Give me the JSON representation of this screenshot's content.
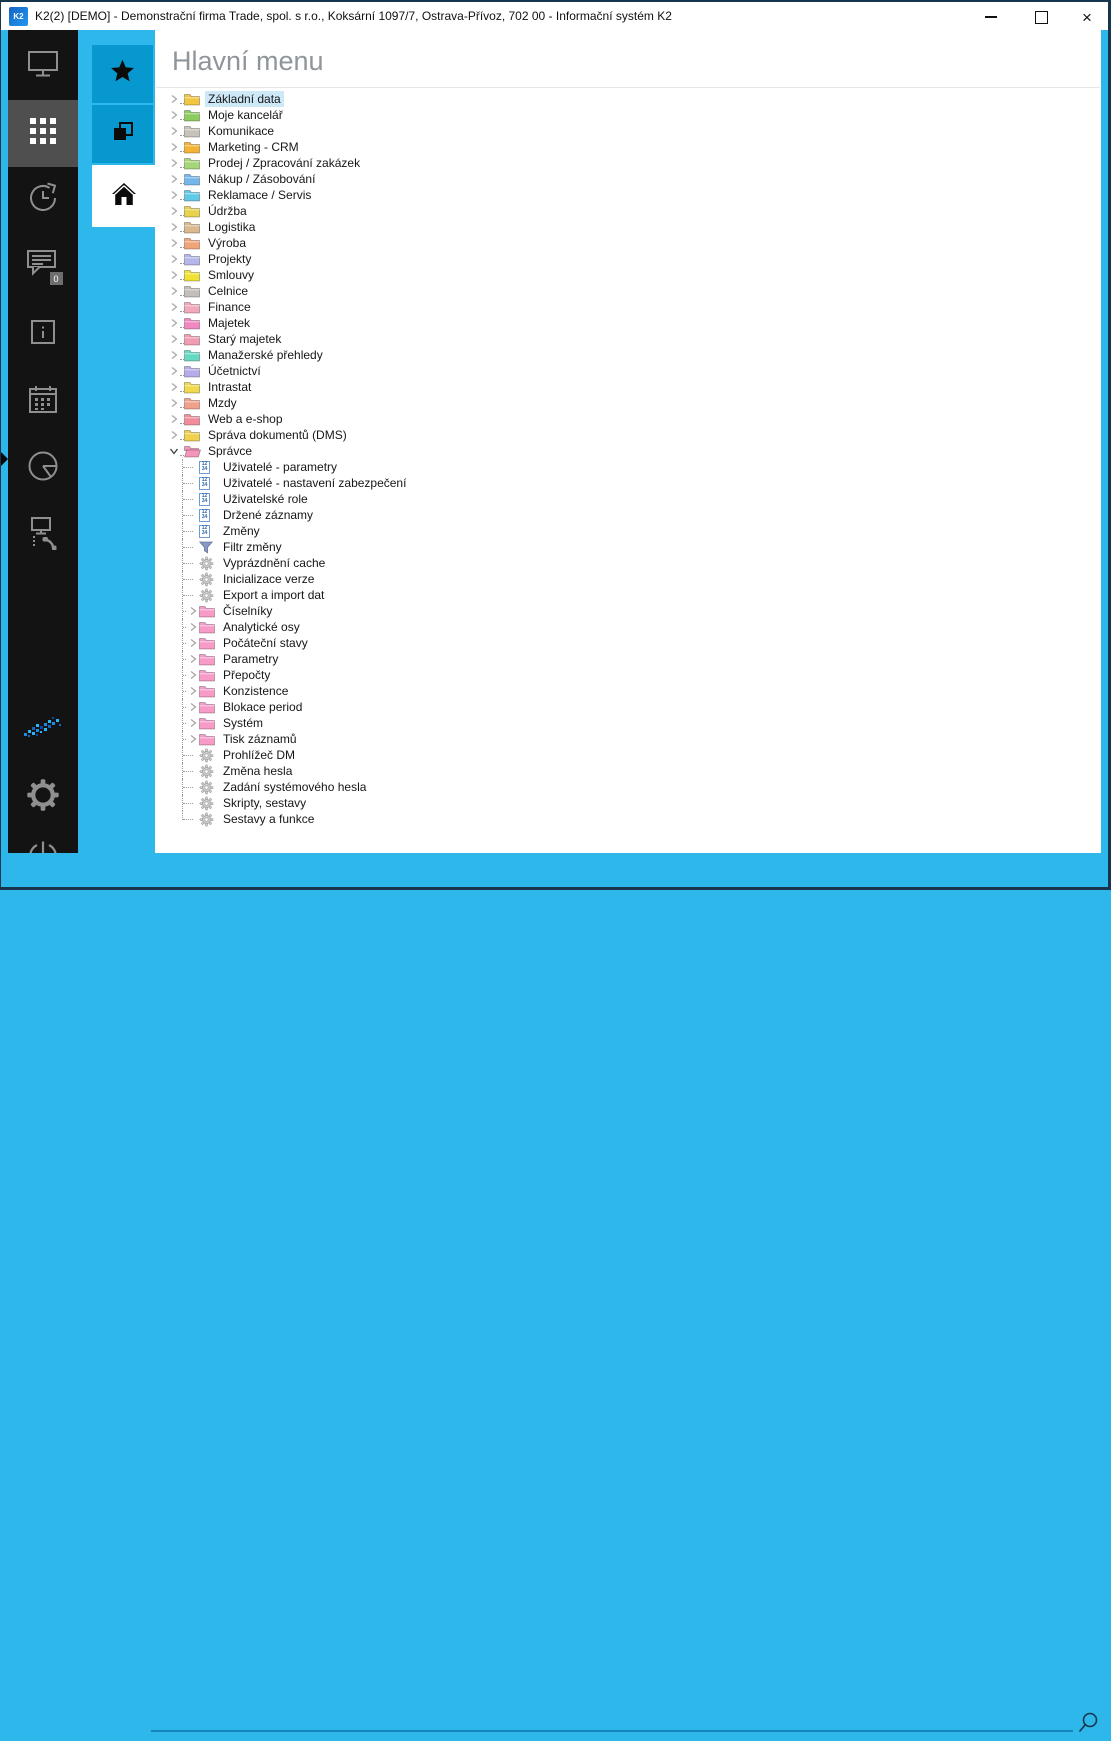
{
  "window": {
    "title": "K2(2) [DEMO] - Demonstrační firma Trade, spol. s r.o., Koksární 1097/7, Ostrava-Přívoz, 702 00 - Informační systém K2",
    "app_icon_text": "K2",
    "controls": [
      {
        "icon": "minimize-icon"
      },
      {
        "icon": "maximize-icon"
      },
      {
        "icon": "close-icon"
      }
    ]
  },
  "colors": {
    "accent_blue": "#2eb7ea",
    "tab_blue": "#0898d0",
    "sidebar_bg": "#131313",
    "selection_highlight": "#cde9f8",
    "frame_border": "#17364e",
    "search_underline": "#1286ba"
  },
  "sidebar": {
    "items": [
      {
        "icon": "desktop-icon",
        "selected": false
      },
      {
        "icon": "apps-grid-icon",
        "selected": true
      },
      {
        "icon": "history-clock-icon",
        "selected": false
      },
      {
        "icon": "chat-icon",
        "selected": false,
        "badge": "0"
      },
      {
        "icon": "info-icon",
        "selected": false
      },
      {
        "icon": "calendar-icon",
        "selected": false
      },
      {
        "icon": "pie-chart-icon",
        "selected": false
      },
      {
        "icon": "remote-phone-icon",
        "selected": false
      }
    ],
    "bottom_items": [
      {
        "icon": "k2-dots-logo-icon"
      },
      {
        "icon": "settings-gear-icon"
      },
      {
        "icon": "power-icon"
      }
    ]
  },
  "rail": {
    "tabs": [
      {
        "icon": "star-icon",
        "selected": false
      },
      {
        "icon": "pages-icon",
        "selected": false
      },
      {
        "icon": "home-icon",
        "selected": true
      }
    ]
  },
  "main": {
    "title": "Hlavní menu"
  },
  "tree": {
    "items": [
      {
        "label": "Základní data",
        "icon": "folder-icon",
        "color": "#f3c63f",
        "expand": "collapsed",
        "level": 0,
        "selected": true
      },
      {
        "label": "Moje kancelář",
        "icon": "folder-icon",
        "color": "#8ccb5e",
        "expand": "collapsed",
        "level": 0,
        "selected": false
      },
      {
        "label": "Komunikace",
        "icon": "folder-icon",
        "color": "#c9c2b9",
        "expand": "collapsed",
        "level": 0,
        "selected": false
      },
      {
        "label": "Marketing - CRM",
        "icon": "folder-icon",
        "color": "#f5b335",
        "expand": "collapsed",
        "level": 0,
        "selected": false
      },
      {
        "label": "Prodej / Zpracování zakázek",
        "icon": "folder-icon",
        "color": "#a5d779",
        "expand": "collapsed",
        "level": 0,
        "selected": false
      },
      {
        "label": "Nákup / Zásobování",
        "icon": "folder-icon",
        "color": "#74b7ec",
        "expand": "collapsed",
        "level": 0,
        "selected": false
      },
      {
        "label": "Reklamace / Servis",
        "icon": "folder-icon",
        "color": "#5fc9e8",
        "expand": "collapsed",
        "level": 0,
        "selected": false
      },
      {
        "label": "Údržba",
        "icon": "folder-icon",
        "color": "#e7d24a",
        "expand": "collapsed",
        "level": 0,
        "selected": false
      },
      {
        "label": "Logistika",
        "icon": "folder-icon",
        "color": "#d9b98d",
        "expand": "collapsed",
        "level": 0,
        "selected": false
      },
      {
        "label": "Výroba",
        "icon": "folder-icon",
        "color": "#f2a479",
        "expand": "collapsed",
        "level": 0,
        "selected": false
      },
      {
        "label": "Projekty",
        "icon": "folder-icon",
        "color": "#b3b7ea",
        "expand": "collapsed",
        "level": 0,
        "selected": false
      },
      {
        "label": "Smlouvy",
        "icon": "folder-icon",
        "color": "#efe234",
        "expand": "collapsed",
        "level": 0,
        "selected": false
      },
      {
        "label": "Celnice",
        "icon": "folder-icon",
        "color": "#c3bfba",
        "expand": "collapsed",
        "level": 0,
        "selected": false
      },
      {
        "label": "Finance",
        "icon": "folder-icon",
        "color": "#f2a8bd",
        "expand": "collapsed",
        "level": 0,
        "selected": false
      },
      {
        "label": "Majetek",
        "icon": "folder-icon",
        "color": "#f287c4",
        "expand": "collapsed",
        "level": 0,
        "selected": false
      },
      {
        "label": "Starý majetek",
        "icon": "folder-icon",
        "color": "#f29cb2",
        "expand": "collapsed",
        "level": 0,
        "selected": false
      },
      {
        "label": "Manažerské přehledy",
        "icon": "folder-icon",
        "color": "#66d9c5",
        "expand": "collapsed",
        "level": 0,
        "selected": false
      },
      {
        "label": "Účetnictví",
        "icon": "folder-icon",
        "color": "#b5aceb",
        "expand": "collapsed",
        "level": 0,
        "selected": false
      },
      {
        "label": "Intrastat",
        "icon": "folder-icon",
        "color": "#f0d94c",
        "expand": "collapsed",
        "level": 0,
        "selected": false
      },
      {
        "label": "Mzdy",
        "icon": "folder-icon",
        "color": "#f2a089",
        "expand": "collapsed",
        "level": 0,
        "selected": false
      },
      {
        "label": "Web a e-shop",
        "icon": "folder-icon",
        "color": "#f28c9b",
        "expand": "collapsed",
        "level": 0,
        "selected": false
      },
      {
        "label": "Správa dokumentů (DMS)",
        "icon": "folder-icon",
        "color": "#f0d04d",
        "expand": "collapsed",
        "level": 0,
        "selected": false
      },
      {
        "label": "Správce",
        "icon": "folder-open-icon",
        "color": "#f495bd",
        "expand": "expanded",
        "level": 0,
        "selected": false
      },
      {
        "label": "Uživatelé - parametry",
        "icon": "records-icon",
        "color": "",
        "expand": null,
        "level": 1,
        "selected": false
      },
      {
        "label": "Uživatelé - nastavení zabezpečení",
        "icon": "records-icon",
        "color": "",
        "expand": null,
        "level": 1,
        "selected": false
      },
      {
        "label": "Uživatelské role",
        "icon": "records-icon",
        "color": "",
        "expand": null,
        "level": 1,
        "selected": false
      },
      {
        "label": "Držené záznamy",
        "icon": "records-icon",
        "color": "",
        "expand": null,
        "level": 1,
        "selected": false
      },
      {
        "label": "Změny",
        "icon": "records-icon",
        "color": "",
        "expand": null,
        "level": 1,
        "selected": false
      },
      {
        "label": "Filtr změny",
        "icon": "filter-funnel-icon",
        "color": "",
        "expand": null,
        "level": 1,
        "selected": false
      },
      {
        "label": "Vyprázdnění cache",
        "icon": "gear-icon",
        "color": "",
        "expand": null,
        "level": 1,
        "selected": false
      },
      {
        "label": "Inicializace verze",
        "icon": "gear-icon",
        "color": "",
        "expand": null,
        "level": 1,
        "selected": false
      },
      {
        "label": "Export a import dat",
        "icon": "gear-icon",
        "color": "",
        "expand": null,
        "level": 1,
        "selected": false
      },
      {
        "label": "Číselníky",
        "icon": "folder-icon",
        "color": "#f89bc9",
        "expand": "collapsed",
        "level": 1,
        "selected": false
      },
      {
        "label": "Analytické osy",
        "icon": "folder-icon",
        "color": "#f89bc9",
        "expand": "collapsed",
        "level": 1,
        "selected": false
      },
      {
        "label": "Počáteční stavy",
        "icon": "folder-icon",
        "color": "#f89bc9",
        "expand": "collapsed",
        "level": 1,
        "selected": false
      },
      {
        "label": "Parametry",
        "icon": "folder-icon",
        "color": "#f89bc9",
        "expand": "collapsed",
        "level": 1,
        "selected": false
      },
      {
        "label": "Přepočty",
        "icon": "folder-icon",
        "color": "#f89bc9",
        "expand": "collapsed",
        "level": 1,
        "selected": false
      },
      {
        "label": "Konzistence",
        "icon": "folder-icon",
        "color": "#f89bc9",
        "expand": "collapsed",
        "level": 1,
        "selected": false
      },
      {
        "label": "Blokace period",
        "icon": "folder-icon",
        "color": "#f89bc9",
        "expand": "collapsed",
        "level": 1,
        "selected": false
      },
      {
        "label": "Systém",
        "icon": "folder-icon",
        "color": "#f89bc9",
        "expand": "collapsed",
        "level": 1,
        "selected": false
      },
      {
        "label": "Tisk záznamů",
        "icon": "folder-icon",
        "color": "#f89bc9",
        "expand": "collapsed",
        "level": 1,
        "selected": false
      },
      {
        "label": "Prohlížeč DM",
        "icon": "gear-icon",
        "color": "",
        "expand": null,
        "level": 1,
        "selected": false
      },
      {
        "label": "Změna hesla",
        "icon": "gear-icon",
        "color": "",
        "expand": null,
        "level": 1,
        "selected": false
      },
      {
        "label": "Zadání systémového hesla",
        "icon": "gear-icon",
        "color": "",
        "expand": null,
        "level": 1,
        "selected": false
      },
      {
        "label": "Skripty, sestavy",
        "icon": "gear-icon",
        "color": "",
        "expand": null,
        "level": 1,
        "selected": false
      },
      {
        "label": "Sestavy a funkce",
        "icon": "gear-icon",
        "color": "",
        "expand": null,
        "level": 1,
        "selected": false
      }
    ]
  },
  "footer": {
    "search_value": "",
    "icon": "search-icon"
  }
}
